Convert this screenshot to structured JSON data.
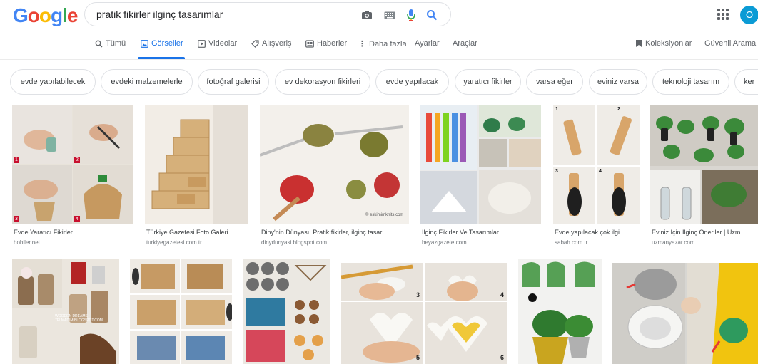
{
  "header": {
    "logo_text": "Google",
    "query": "pratik fikirler ilginç tasarımlar",
    "avatar_letter": "O"
  },
  "tabs": {
    "all": "Tümü",
    "images": "Görseller",
    "videos": "Videolar",
    "shopping": "Alışveriş",
    "news": "Haberler",
    "more": "Daha fazla",
    "settings": "Ayarlar",
    "tools": "Araçlar",
    "collections": "Koleksiyonlar",
    "safe_search": "Güvenli Arama"
  },
  "chips": [
    "evde yapılabilecek",
    "evdeki malzemelerle",
    "fotoğraf galerisi",
    "ev dekorasyon fikirleri",
    "evde yapılacak",
    "yaratıcı fikirler",
    "varsa eğer",
    "eviniz varsa",
    "teknoloji tasarım",
    "ker"
  ],
  "results_row1": [
    {
      "caption": "Evde Yaratıcı Fikirler",
      "domain": "hobiler.net"
    },
    {
      "caption": "Türkiye Gazetesi Foto Galeri...",
      "domain": "turkiyegazetesi.com.tr"
    },
    {
      "caption": "Diny'nin Dünyası: Pratik fikirler, ilginç tasarı...",
      "domain": "dinydunyasi.blogspot.com"
    },
    {
      "caption": "İlginç Fikirler Ve Tasarımlar",
      "domain": "beyazgazete.com"
    },
    {
      "caption": "Evde yapılacak çok ilgi...",
      "domain": "sabah.com.tr"
    },
    {
      "caption": "Eviniz İçin İlginç Öneriler | Uzm...",
      "domain": "uzmanyazar.com"
    }
  ],
  "image_overlays": {
    "watermark_row1": "© eskimimknits.com",
    "watermark_row2": "WOODEN DREAMS 7ELMADIM.BLOGSPOT.COM",
    "panel_numbers": [
      "1",
      "2",
      "3",
      "4"
    ],
    "egg_numbers": [
      "3",
      "4",
      "5",
      "6"
    ]
  },
  "colors": {
    "accent": "#1a73e8",
    "logo_blue": "#4285f4",
    "logo_red": "#ea4335",
    "logo_yellow": "#fbbc05",
    "logo_green": "#34a853"
  }
}
